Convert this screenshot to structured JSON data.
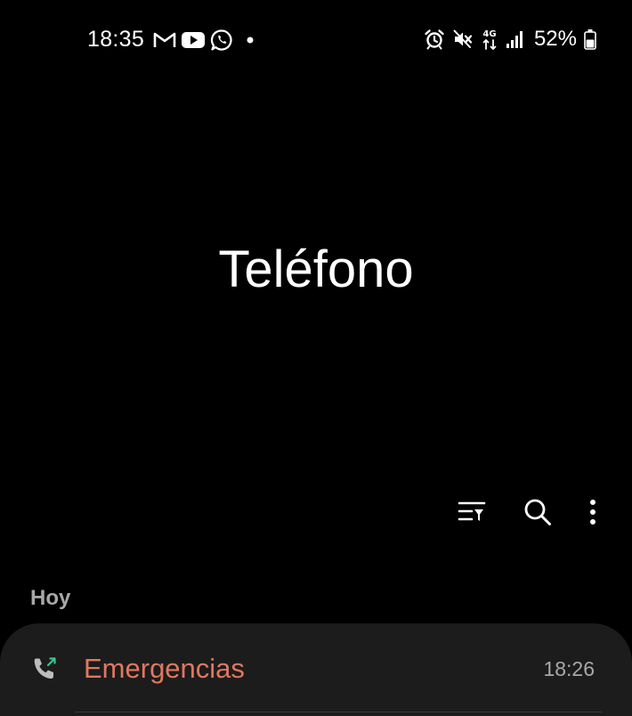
{
  "status_bar": {
    "time": "18:35",
    "battery_percent": "52%",
    "network": "4G",
    "left_icons": [
      "gmail-icon",
      "youtube-icon",
      "whatsapp-icon",
      "notification-dot-icon"
    ],
    "right_icons": [
      "alarm-icon",
      "mute-icon",
      "4g-data-icon",
      "signal-icon",
      "battery-icon"
    ],
    "battery_level": 0.52
  },
  "header": {
    "title": "Teléfono"
  },
  "toolbar": {
    "items": [
      {
        "icon": "filter-list-icon"
      },
      {
        "icon": "search-icon"
      },
      {
        "icon": "more-options-icon"
      }
    ]
  },
  "call_log": {
    "sections": [
      {
        "header": "Hoy",
        "calls": [
          {
            "name": "Emergencias",
            "time": "18:26",
            "type_icon": "outgoing-call-icon"
          }
        ]
      }
    ]
  },
  "colors": {
    "background": "#000000",
    "card_background": "#1c1c1c",
    "primary_text": "#ffffff",
    "secondary_text": "#a8a8a8",
    "emergency_name": "#e07760",
    "outgoing_arrow": "#3ec28f"
  }
}
